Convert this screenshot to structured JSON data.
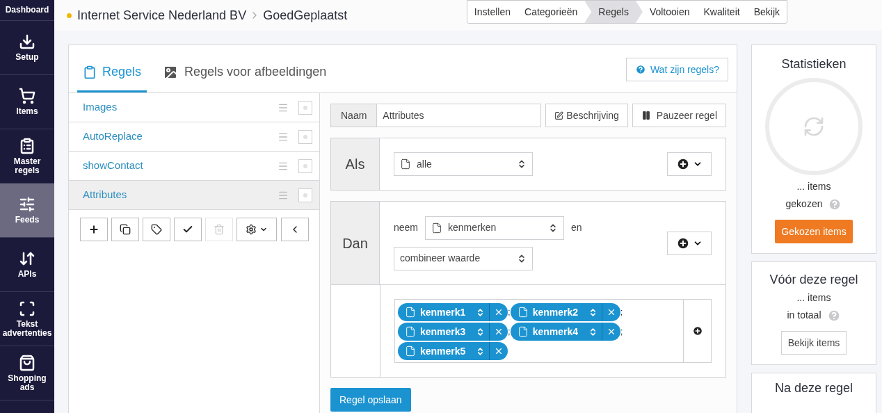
{
  "sidebar": {
    "items": [
      {
        "label": "Dashboard",
        "kind": "none",
        "selected": false
      },
      {
        "label": "Setup",
        "kind": "download",
        "selected": false
      },
      {
        "label": "Items",
        "kind": "cart",
        "selected": false
      },
      {
        "label": "Master regels",
        "kind": "clipboard",
        "selected": false
      },
      {
        "label": "Feeds",
        "kind": "sliders",
        "selected": true
      },
      {
        "label": "APIs",
        "kind": "arrows",
        "selected": false
      },
      {
        "label": "Tekst advertenties",
        "kind": "scan",
        "selected": false
      },
      {
        "label": "Shopping ads",
        "kind": "bag",
        "selected": false
      }
    ]
  },
  "header": {
    "breadcrumb": [
      "Internet Service Nederland BV",
      "GoedGeplaatst"
    ],
    "steps": [
      {
        "label": "Instellen",
        "selected": false
      },
      {
        "label": "Categorieën",
        "selected": false
      },
      {
        "label": "Regels",
        "selected": true
      },
      {
        "label": "Voltooien",
        "selected": false
      },
      {
        "label": "Kwaliteit",
        "selected": false
      },
      {
        "label": "Bekijk",
        "selected": false
      }
    ]
  },
  "tabs": [
    {
      "label": "Regels",
      "kind": "clipboard",
      "selected": true
    },
    {
      "label": "Regels voor afbeeldingen",
      "kind": "image",
      "selected": false
    }
  ],
  "help_button": "Wat zijn regels?",
  "rules": [
    {
      "name": "Images",
      "selected": false
    },
    {
      "name": "AutoReplace",
      "selected": false
    },
    {
      "name": "showContact",
      "selected": false
    },
    {
      "name": "Attributes",
      "selected": true
    }
  ],
  "rule_toolbar": [
    {
      "kind": "plus",
      "disabled": false
    },
    {
      "kind": "copy",
      "disabled": false
    },
    {
      "kind": "tag",
      "disabled": false
    },
    {
      "kind": "check",
      "disabled": false
    },
    {
      "kind": "trash",
      "disabled": true
    },
    {
      "kind": "gear",
      "disabled": false
    },
    {
      "kind": "back",
      "disabled": false
    }
  ],
  "editor": {
    "name_label": "Naam",
    "name_value": "Attributes",
    "description_button": "Beschrijving",
    "pause_button": "Pauzeer regel",
    "if_label": "Als",
    "if_select": "alle",
    "then_label": "Dan",
    "then_prefix": "neem",
    "then_select": "kenmerken",
    "then_suffix": "en",
    "action_select": "combineer waarde",
    "tokens": [
      {
        "kind": "chip",
        "label": "kenmerk1"
      },
      {
        "kind": "separator",
        "label": ";"
      },
      {
        "kind": "chip",
        "label": "kenmerk2"
      },
      {
        "kind": "separator",
        "label": ";"
      },
      {
        "kind": "chip",
        "label": "kenmerk3"
      },
      {
        "kind": "separator",
        "label": ";"
      },
      {
        "kind": "chip",
        "label": "kenmerk4"
      },
      {
        "kind": "separator",
        "label": ";"
      },
      {
        "kind": "chip",
        "label": "kenmerk5"
      }
    ],
    "save_button": "Regel opslaan"
  },
  "stats": {
    "title": "Statistieken",
    "count": "... items",
    "count_label": "gekozen",
    "button": "Gekozen items"
  },
  "before": {
    "title": "Vóór deze regel",
    "count": "... items",
    "count_label": "in totaal",
    "button": "Bekijk items"
  },
  "after": {
    "title": "Na deze regel"
  }
}
